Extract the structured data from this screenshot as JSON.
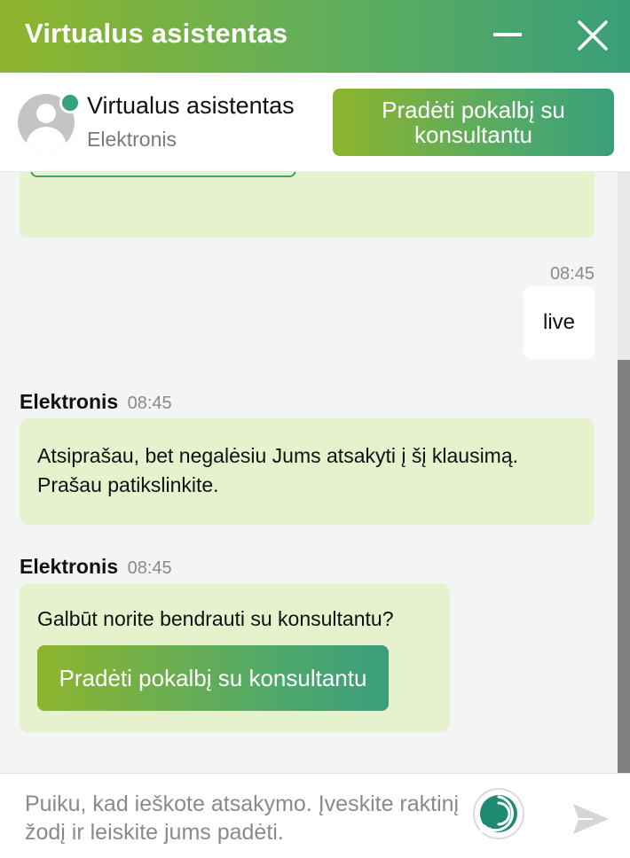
{
  "header": {
    "title": "Virtualus asistentas"
  },
  "agent": {
    "name": "Virtualus asistentas",
    "subtitle": "Elektronis",
    "consult_button": "Pradėti pokalbį su konsultantu"
  },
  "messages": {
    "user": {
      "time": "08:45",
      "text": "live"
    },
    "bot1": {
      "sender": "Elektronis",
      "time": "08:45",
      "line1": "Atsiprašau, bet negalėsiu Jums atsakyti į šį klausimą.",
      "line2": "Prašau patikslinkite."
    },
    "bot2": {
      "sender": "Elektronis",
      "time": "08:45",
      "text": "Galbūt norite bendrauti su konsultantu?",
      "button": "Pradėti pokalbį su konsultantu"
    }
  },
  "composer": {
    "placeholder": "Puiku, kad ieškote atsakymo. Įveskite raktinį žodį ir leiskite jums padėti."
  },
  "colors": {
    "brand_green_start": "#8fb52c",
    "brand_green_end": "#3a9e78",
    "bubble_bg": "#e5f2cd",
    "online": "#33a37c"
  }
}
